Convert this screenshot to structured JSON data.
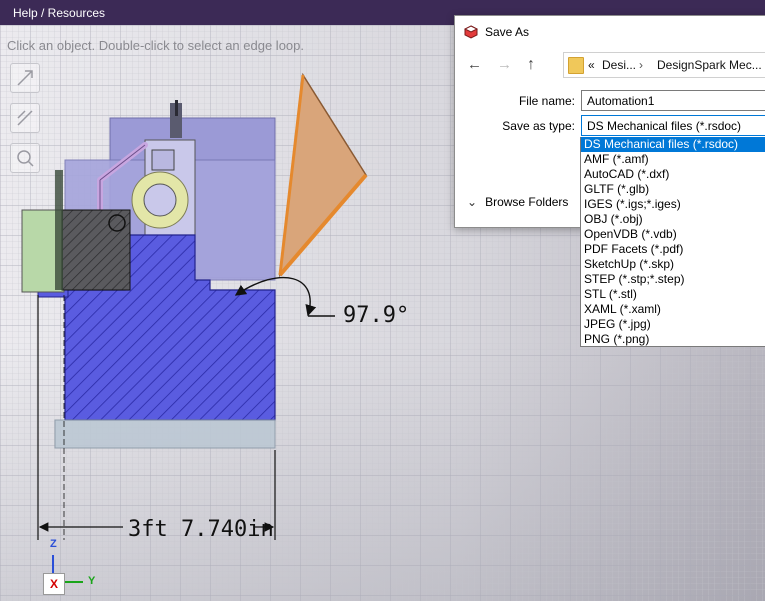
{
  "app": {
    "menu_label": "Help / Resources",
    "viewport_hint": "Click an object. Double-click to select an edge loop."
  },
  "annotations": {
    "angle": "97.9°",
    "dimension": "3ft  7.740in"
  },
  "triad": {
    "z": "Z",
    "x": "X",
    "y": "Y"
  },
  "dialog": {
    "title": "Save As",
    "breadcrumb": [
      "«",
      "Desi...",
      "DesignSpark Mec..."
    ],
    "file_name_label": "File name:",
    "file_name_value": "Automation1",
    "save_type_label": "Save as type:",
    "save_type_value": "DS Mechanical files (*.rsdoc)",
    "browse_folders": "Browse Folders",
    "type_options": [
      "DS Mechanical files (*.rsdoc)",
      "AMF (*.amf)",
      "AutoCAD (*.dxf)",
      "GLTF (*.glb)",
      "IGES (*.igs;*.iges)",
      "OBJ (*.obj)",
      "OpenVDB (*.vdb)",
      "PDF Facets (*.pdf)",
      "SketchUp (*.skp)",
      "STEP (*.stp;*.step)",
      "STL (*.stl)",
      "XAML (*.xaml)",
      "JPEG (*.jpg)",
      "PNG (*.png)"
    ],
    "selected_option_index": 0
  },
  "colors": {
    "title_bar": "#3c2a56",
    "selection": "#0078d7",
    "part_blue": "#5a5ce0",
    "part_lavender": "#9b9ad6",
    "flap": "#d9a57a"
  }
}
